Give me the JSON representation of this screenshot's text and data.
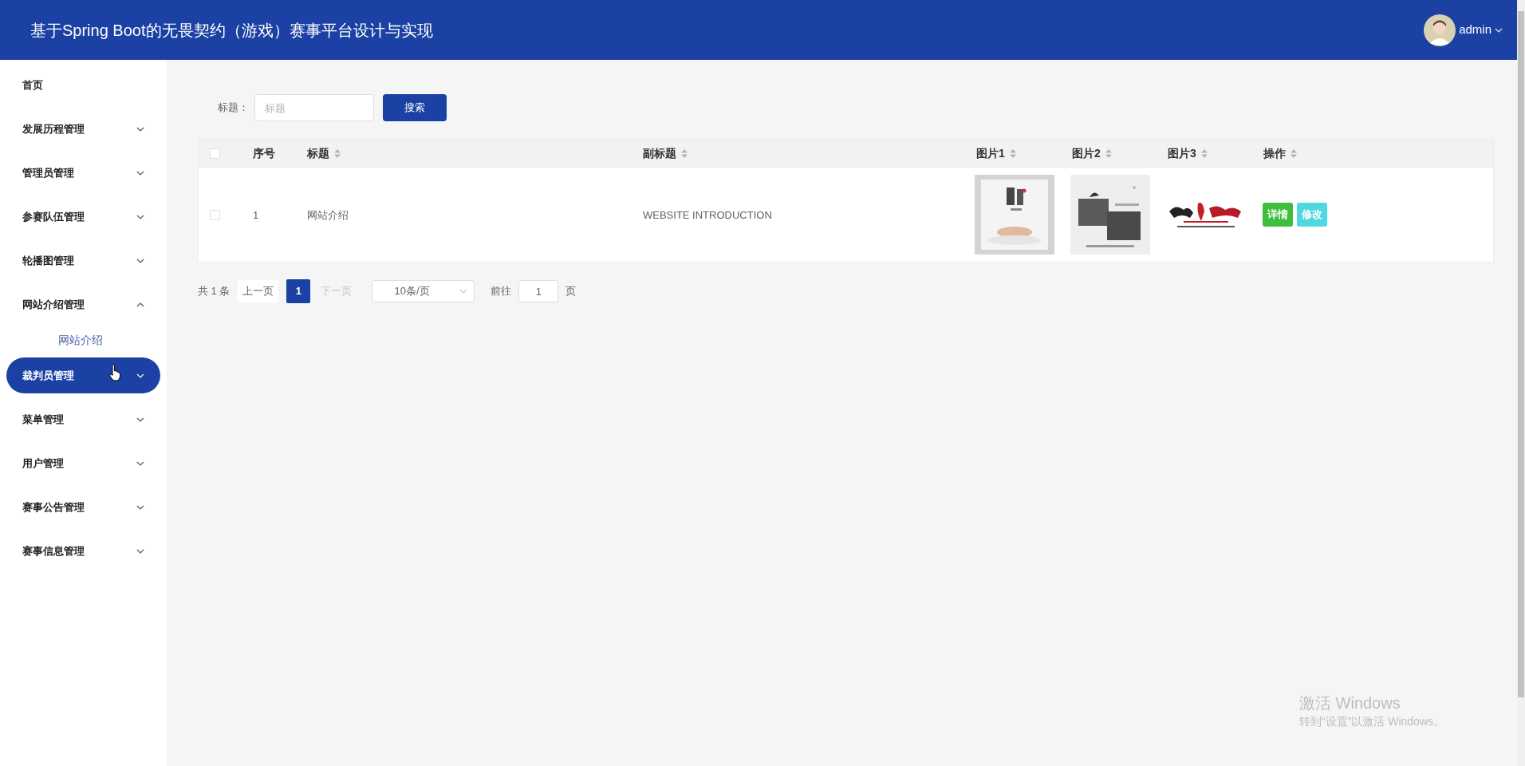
{
  "header": {
    "title": "基于Spring Boot的无畏契约（游戏）赛事平台设计与实现",
    "user": "admin"
  },
  "sidebar": {
    "items": [
      {
        "label": "首页",
        "kind": "link",
        "selected": false
      },
      {
        "label": "发展历程管理",
        "kind": "group",
        "expanded": false,
        "selected": false
      },
      {
        "label": "管理员管理",
        "kind": "group",
        "expanded": false,
        "selected": false
      },
      {
        "label": "参赛队伍管理",
        "kind": "group",
        "expanded": false,
        "selected": false
      },
      {
        "label": "轮播图管理",
        "kind": "group",
        "expanded": false,
        "selected": false
      },
      {
        "label": "网站介绍管理",
        "kind": "group",
        "expanded": true,
        "selected": false,
        "children": [
          {
            "label": "网站介绍",
            "selected": true
          }
        ]
      },
      {
        "label": "裁判员管理",
        "kind": "group",
        "expanded": false,
        "selected": true
      },
      {
        "label": "菜单管理",
        "kind": "group",
        "expanded": false,
        "selected": false
      },
      {
        "label": "用户管理",
        "kind": "group",
        "expanded": false,
        "selected": false
      },
      {
        "label": "赛事公告管理",
        "kind": "group",
        "expanded": false,
        "selected": false
      },
      {
        "label": "赛事信息管理",
        "kind": "group",
        "expanded": false,
        "selected": false
      }
    ]
  },
  "search": {
    "label": "标题：",
    "placeholder": "标题",
    "button": "搜索"
  },
  "table": {
    "select_all": {
      "checked": false
    },
    "columns": [
      {
        "label": "序号",
        "sortable": false
      },
      {
        "label": "标题",
        "sortable": true
      },
      {
        "label": "副标题",
        "sortable": true
      },
      {
        "label": "图片1",
        "sortable": true
      },
      {
        "label": "图片2",
        "sortable": true
      },
      {
        "label": "图片3",
        "sortable": true
      },
      {
        "label": "操作",
        "sortable": true
      }
    ],
    "rows": [
      {
        "checked": false,
        "index": "1",
        "title": "网站介绍",
        "subtitle": "WEBSITE INTRODUCTION",
        "images": [
          {
            "kind": "picture"
          },
          {
            "kind": "picture"
          },
          {
            "kind": "picture"
          }
        ],
        "actions": [
          {
            "label": "详情",
            "kind": "detail"
          },
          {
            "label": "修改",
            "kind": "edit"
          }
        ]
      }
    ]
  },
  "pagination": {
    "total": "共 1 条",
    "prev": "上一页",
    "pages": [
      {
        "label": "1",
        "selected": true
      }
    ],
    "next": "下一页",
    "next_disabled": true,
    "page_size": "10条/页",
    "goto_label": "前往",
    "goto_value": "1",
    "goto_suffix": "页"
  },
  "os_notice": {
    "title": "激活 Windows",
    "text": "转到“设置”以激活 Windows。"
  }
}
